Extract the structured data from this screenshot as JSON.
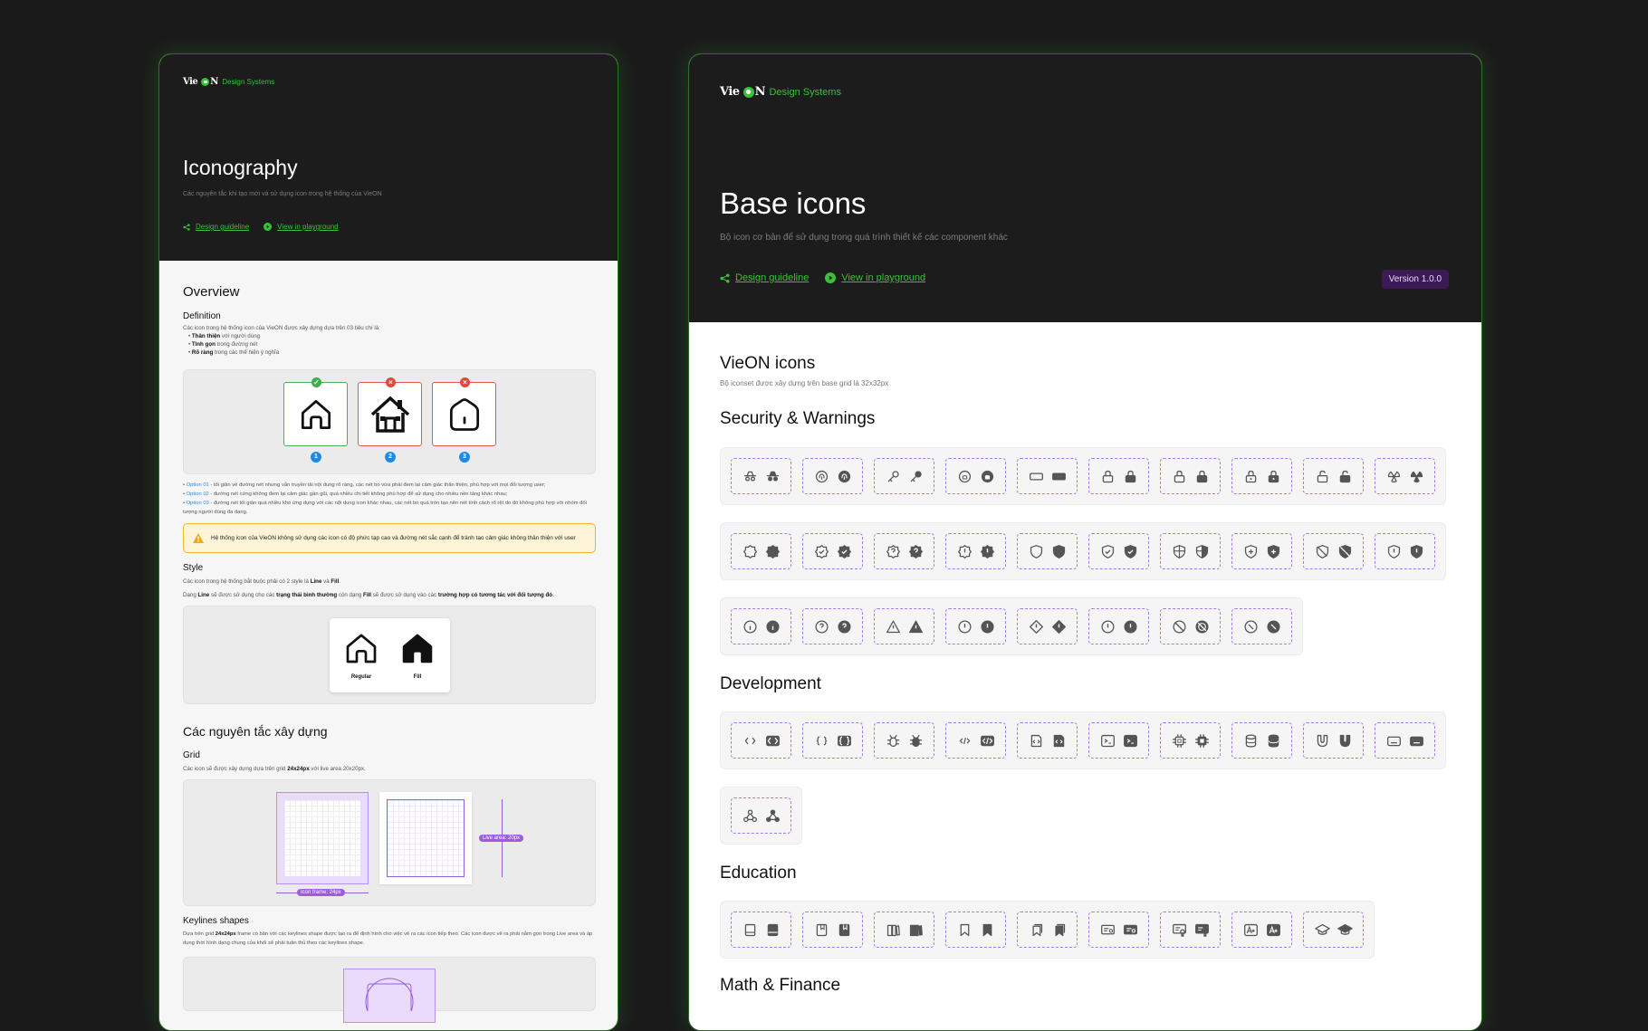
{
  "left": {
    "brand": {
      "vie": "Vie",
      "n": "N",
      "suffix": "Design Systems"
    },
    "title": "Iconography",
    "subtitle": "Các nguyên tắc khi tạo mới và sử dụng icon trong hệ thống của VieON",
    "links": {
      "guideline": "Design guideline",
      "playground": "View in playground"
    },
    "overview": {
      "heading": "Overview",
      "definition_heading": "Definition",
      "definition_intro": "Các icon trong hệ thống icon của VieON được xây dựng dựa trên 03 tiêu chí là:",
      "criteria": [
        {
          "bold": "Thân thiện",
          "rest": " với người dùng"
        },
        {
          "bold": "Tinh gọn",
          "rest": " trong đường nét"
        },
        {
          "bold": "Rõ ràng",
          "rest": " trong các thể hiện ý nghĩa"
        }
      ],
      "option_numbers": [
        "1",
        "2",
        "3"
      ],
      "options": [
        {
          "label": "Option 01",
          "text": " - tối giản về đường nét nhưng vẫn truyền tải nội dung rõ ràng, các nét bo vừa phải đem lại cảm giác thân thiện, phù hợp với mọi đối tượng user;"
        },
        {
          "label": "Option 02",
          "text": " - đường nét cứng không đem lại cảm giác gần gũi, quá nhiều chi tiết không phù hợp để sử dụng cho nhiều nền tảng khác nhau;"
        },
        {
          "label": "Option 03",
          "text": " - đường nét tối giản quá nhiều khó ứng dụng với các nội dung icon khác nhau, các nét bo quá tròn tạo nên nét tính cách rõ rệt do đó không phù hợp với nhóm đối tượng người dùng đa dạng."
        }
      ],
      "warning": "Hệ thống icon của VieON không sử dụng các icon có độ phức tạp cao và đường nét sắc cạnh để tránh tạo cảm giác không thân thiện với user"
    },
    "style": {
      "heading": "Style",
      "p1_a": "Các icon trong hệ thống bắt buộc phải có 2 style là ",
      "p1_line": "Line",
      "p1_and": " và ",
      "p1_fill": "Fill",
      "p1_end": ".",
      "p2_a": "Dạng ",
      "p2_line": "Line",
      "p2_b": " sẽ được sử dụng cho các ",
      "p2_state": "trạng thái bình thường",
      "p2_c": " còn dạng ",
      "p2_fill": "Fill",
      "p2_d": " sẽ được sử dụng vào các ",
      "p2_interactive": "trường hợp có tương tác với đối tượng đó",
      "p2_end": ".",
      "regular": "Regular",
      "fill": "Fill"
    },
    "principles": {
      "heading": "Các nguyên tắc xây dựng",
      "grid_heading": "Grid",
      "grid_a": "Các icon sẽ được xây dựng dựa trên grid ",
      "grid_size": "24x24px",
      "grid_b": " với live area 20x20px.",
      "live_area": "Live area: 20px",
      "icon_frame": "Icon frame: 24px",
      "keylines_heading": "Keylines shapes",
      "keylines_a": "Dựa trên grid ",
      "keylines_size": "24x24px",
      "keylines_b": " frame có bản với các keylines shape được tạo ra để định hình cho việc vẽ ra các icon tiếp theo. Các icon được vẽ ra phải nằm gọn trong Live area và áp dụng thời hình dạng chung của khối sẽ phải tuân thủ theo các keylines shape."
    }
  },
  "right": {
    "brand": {
      "vie": "Vie",
      "n": "N",
      "suffix": "Design Systems"
    },
    "title": "Base icons",
    "subtitle": "Bộ icon cơ bản để sử dụng trong quá trình thiết kế các component khác",
    "links": {
      "guideline": "Design guideline",
      "playground": "View in playground"
    },
    "version": "Version 1.0.0",
    "vieon_icons": {
      "heading": "VieON icons",
      "subtitle": "Bộ iconset được xây dựng trên base grid là 32x32px"
    },
    "sections": {
      "security": "Security & Warnings",
      "development": "Development",
      "education": "Education",
      "math": "Math & Finance"
    },
    "icons": {
      "security_row1": [
        "incognito",
        "fingerprint",
        "key",
        "password",
        "password-field",
        "lock",
        "lock-closed",
        "lock-keyhole",
        "lock-open",
        "radioactive"
      ],
      "security_row2": [
        "badge",
        "badge-check",
        "badge-question",
        "badge-alert",
        "shield",
        "shield-check",
        "shield-half",
        "shield-plus",
        "shield-off",
        "shield-alert"
      ],
      "security_row3": [
        "info",
        "question",
        "warning-triangle",
        "alert-circle",
        "alert-diamond",
        "error",
        "prohibited",
        "block"
      ],
      "development_row1": [
        "code-brackets",
        "curly-brackets",
        "bug",
        "code-tags",
        "file-code",
        "terminal",
        "cpu",
        "database",
        "magnet",
        "keyboard"
      ],
      "development_row2": [
        "webhook"
      ],
      "education_row1": [
        "notebook",
        "book-bookmark",
        "books",
        "bookmark",
        "bookmark-multiple",
        "certificate",
        "award",
        "font-size",
        "graduation-cap"
      ]
    }
  }
}
